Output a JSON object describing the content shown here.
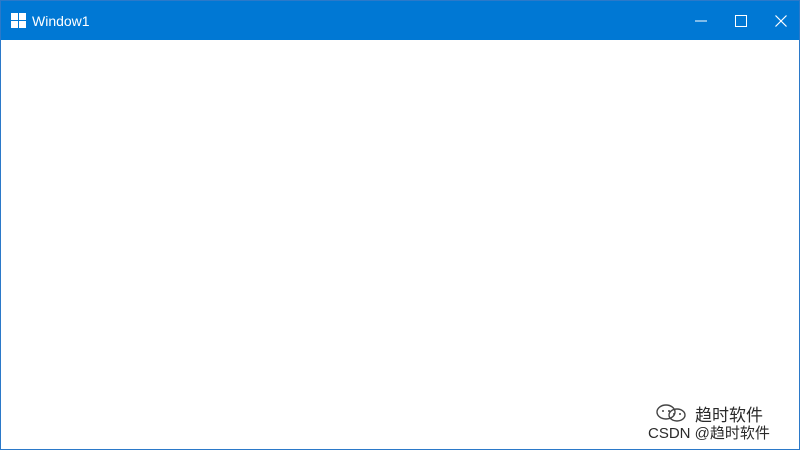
{
  "window": {
    "title": "Window1",
    "colors": {
      "titlebar": "#0078d4",
      "titlebar_text": "#ffffff",
      "client_background": "#ffffff"
    },
    "icons": {
      "app": "windows-logo-icon",
      "minimize": "minimize-icon",
      "maximize": "maximize-icon",
      "close": "close-icon"
    }
  },
  "watermark": {
    "icon": "wechat-icon",
    "brand": "趋时软件",
    "credit": "CSDN @趋时软件"
  }
}
